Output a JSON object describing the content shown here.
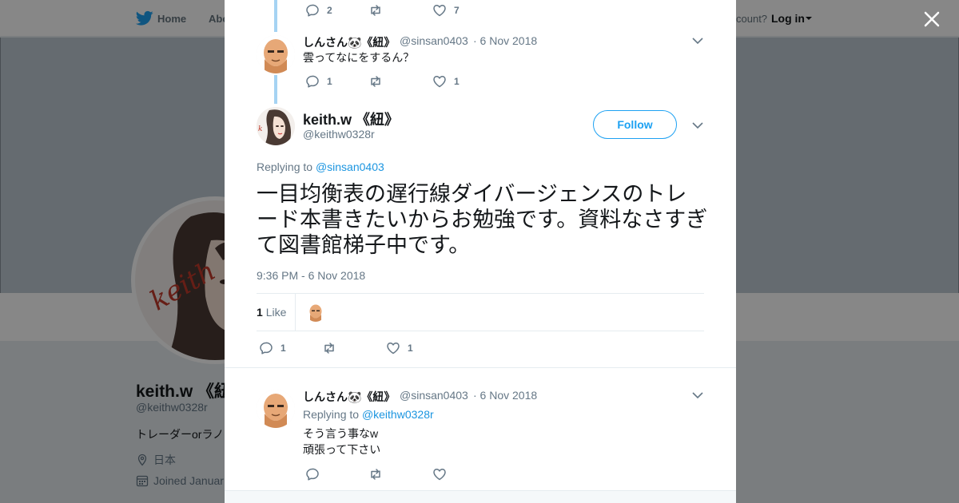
{
  "topbar": {
    "home": "Home",
    "about": "Abo",
    "account_prompt": "count?",
    "login": "Log in"
  },
  "profile": {
    "name": "keith.w 《紐",
    "handle": "@keithw0328r",
    "bio": "トレーダーorラノ",
    "location": "日本",
    "joined": "Joined Januar"
  },
  "thread": {
    "prev_tweet_actions": {
      "replies": "2",
      "likes": "7"
    },
    "parent": {
      "name": "しんさん🐼《紐》",
      "handle": "@sinsan0403",
      "date": "· 6 Nov 2018",
      "text": "雲ってなにをするん？",
      "replies": "1",
      "likes": "1"
    },
    "main": {
      "name": "keith.w 《紐》",
      "handle": "@keithw0328r",
      "follow_label": "Follow",
      "replying_label": "Replying to",
      "replying_to": "@sinsan0403",
      "text": "一目均衡表の遅行線ダイバージェンスのトレード本書きたいからお勉強です。資料なさすぎて図書館梯子中です。",
      "time": "9:36 PM - 6 Nov 2018",
      "likes_count": "1",
      "likes_label": "Like",
      "replies": "1",
      "likes": "1"
    },
    "reply": {
      "name": "しんさん🐼《紐》",
      "handle": "@sinsan0403",
      "date": "· 6 Nov 2018",
      "replying_label": "Replying to",
      "replying_to": "@keithw0328r",
      "line1": "そう言う事なw",
      "line2": "頑張って下さい"
    }
  },
  "colors": {
    "accent": "#1da1f2",
    "link": "#1b95e0",
    "thread_line": "#a5d3f3",
    "muted": "#657786"
  }
}
